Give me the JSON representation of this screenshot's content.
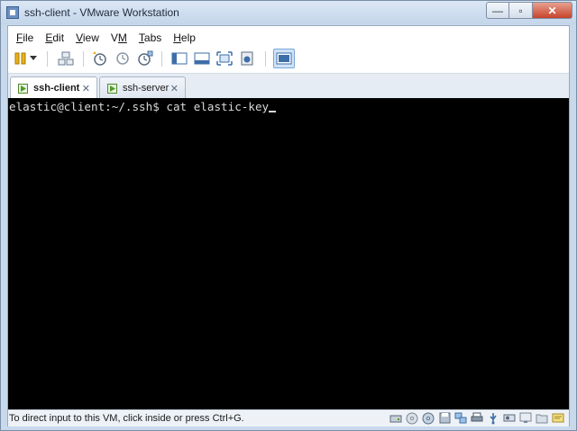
{
  "window": {
    "title": "ssh-client - VMware Workstation",
    "caption_buttons": {
      "minimize": "—",
      "maximize": "▫",
      "close": "✕"
    }
  },
  "menubar": {
    "items": [
      {
        "label": "File",
        "mnemonic": "F"
      },
      {
        "label": "Edit",
        "mnemonic": "E"
      },
      {
        "label": "View",
        "mnemonic": "V"
      },
      {
        "label": "VM",
        "mnemonic": "M"
      },
      {
        "label": "Tabs",
        "mnemonic": "T"
      },
      {
        "label": "Help",
        "mnemonic": "H"
      }
    ]
  },
  "toolbar": {
    "icons": [
      "pause-icon",
      "dropdown-arrow-icon",
      "send-ctrl-alt-del-icon",
      "take-snapshot-icon",
      "revert-snapshot-icon",
      "snapshot-manager-icon",
      "show-library-icon",
      "thumbnail-bar-icon",
      "full-screen-icon",
      "unity-icon",
      "console-view-icon"
    ]
  },
  "tabs": [
    {
      "label": "ssh-client",
      "active": true
    },
    {
      "label": "ssh-server",
      "active": false
    }
  ],
  "console": {
    "prompt": "elastic@client:~/.ssh$ cat elastic-key"
  },
  "statusbar": {
    "hint": "To direct input to this VM, click inside or press Ctrl+G."
  },
  "colors": {
    "console_bg": "#000000",
    "console_text": "#d8d8d8",
    "chrome": "#c9d9ec"
  }
}
